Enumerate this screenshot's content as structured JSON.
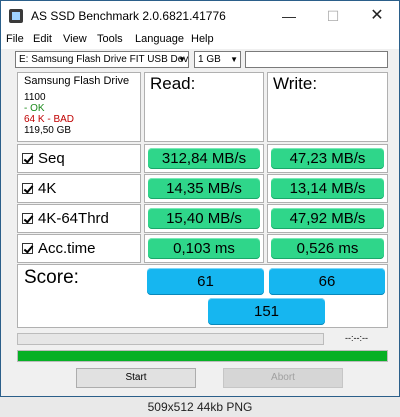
{
  "window": {
    "title": "AS SSD Benchmark 2.0.6821.41776",
    "minimize_glyph": "—",
    "maximize_glyph": "☐",
    "close_glyph": "✕"
  },
  "menu": [
    "File",
    "Edit",
    "View",
    "Tools",
    "Language",
    "Help"
  ],
  "toolbar": {
    "drive": "E: Samsung Flash Drive FIT USB Device",
    "size": "1 GB",
    "text_value": ""
  },
  "drive_info": {
    "name": "Samsung Flash Drive",
    "firmware": "1100",
    "status1": " - OK",
    "status2": "64 K - BAD",
    "capacity": "119,50 GB"
  },
  "headers": {
    "read": "Read:",
    "write": "Write:"
  },
  "rows": [
    {
      "label": "Seq",
      "read": "312,84 MB/s",
      "write": "47,23 MB/s"
    },
    {
      "label": "4K",
      "read": "14,35 MB/s",
      "write": "13,14 MB/s"
    },
    {
      "label": "4K-64Thrd",
      "read": "15,40 MB/s",
      "write": "47,92 MB/s"
    },
    {
      "label": "Acc.time",
      "read": "0,103 ms",
      "write": "0,526 ms"
    }
  ],
  "score": {
    "label": "Score:",
    "read": "61",
    "write": "66",
    "total": "151"
  },
  "progress": {
    "timer": "--:--:--",
    "total_fraction": 1.0
  },
  "buttons": {
    "start": "Start",
    "abort": "Abort"
  },
  "footer": "509x512 44kb PNG",
  "colors": {
    "result": "#2fd68a",
    "score": "#16b6f0",
    "progress": "#06b025",
    "bad": "#c00000",
    "ok": "#1a8a1a"
  }
}
